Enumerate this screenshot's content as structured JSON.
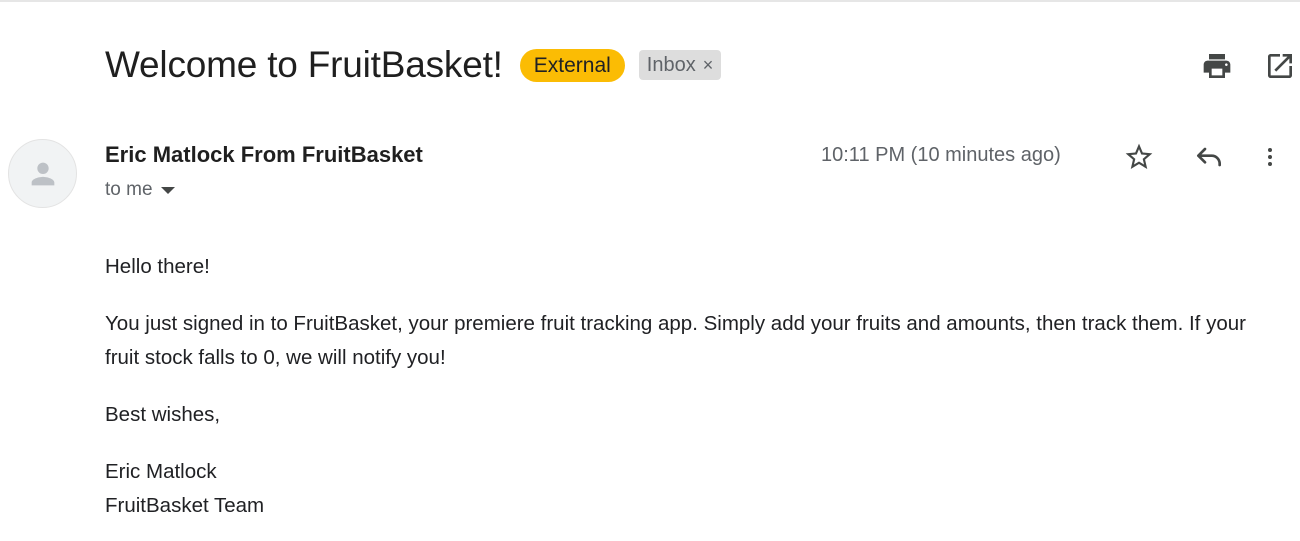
{
  "email": {
    "subject": "Welcome to FruitBasket!",
    "labels": {
      "external": "External",
      "inbox": "Inbox",
      "remove_glyph": "×"
    },
    "sender": {
      "name": "Eric Matlock From FruitBasket",
      "recipient_line": "to me"
    },
    "timestamp": "10:11 PM (10 minutes ago)",
    "body": {
      "greeting": "Hello there!",
      "paragraph": "You just signed in to FruitBasket, your premiere fruit tracking app. Simply add your fruits and amounts, then track them. If your fruit stock falls to 0, we will notify you!",
      "closing": "Best wishes,",
      "signature_name": "Eric Matlock",
      "signature_team": "FruitBasket Team"
    }
  },
  "icons": {
    "print": "print-icon",
    "open_new_window": "open-in-new-icon",
    "avatar": "person-icon",
    "star": "star-outline-icon",
    "reply": "reply-icon",
    "more": "more-vert-icon",
    "recipient_caret": "caret-down-icon"
  },
  "colors": {
    "external_badge": "#fbbc04",
    "inbox_badge": "#dddddd",
    "icon": "#444746",
    "secondary_text": "#5f6368"
  }
}
